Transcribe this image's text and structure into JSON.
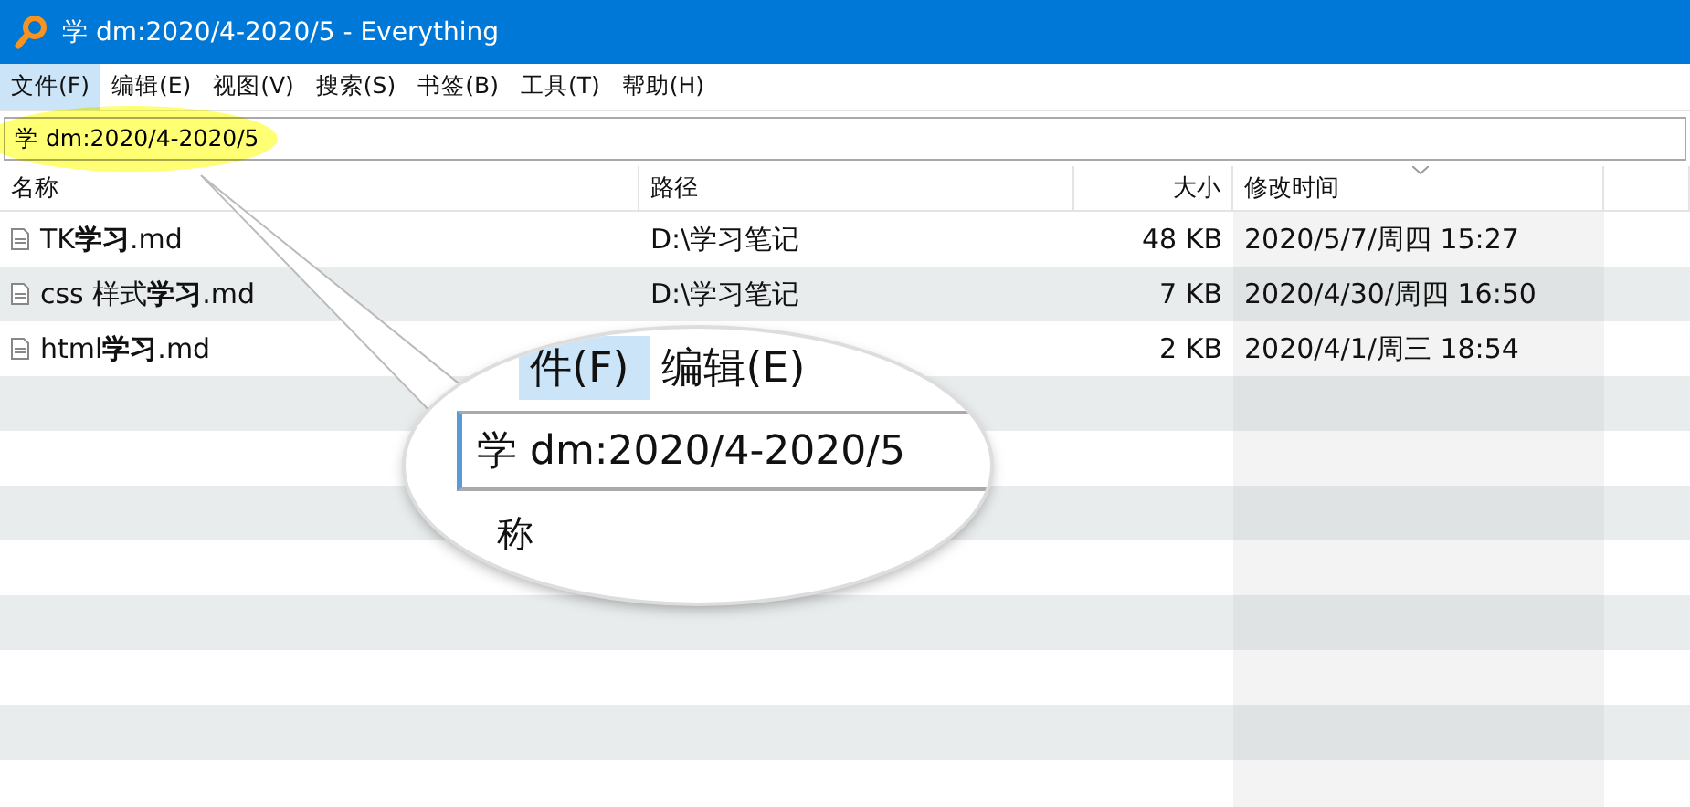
{
  "window": {
    "title": "学 dm:2020/4-2020/5 - Everything"
  },
  "menu": [
    {
      "label": "文件(F)",
      "selected": true
    },
    {
      "label": "编辑(E)",
      "selected": false
    },
    {
      "label": "视图(V)",
      "selected": false
    },
    {
      "label": "搜索(S)",
      "selected": false
    },
    {
      "label": "书签(B)",
      "selected": false
    },
    {
      "label": "工具(T)",
      "selected": false
    },
    {
      "label": "帮助(H)",
      "selected": false
    }
  ],
  "search": {
    "value": "学 dm:2020/4-2020/5"
  },
  "table": {
    "columns": [
      "名称",
      "路径",
      "大小",
      "修改时间"
    ],
    "rows": [
      {
        "name": "TK**学习**.md",
        "path": "D:\\学习笔记",
        "size": "48 KB",
        "modified": "2020/5/7/周四 15:27"
      },
      {
        "name": "css 样式**学习**.md",
        "path": "D:\\学习笔记",
        "size": "7 KB",
        "modified": "2020/4/30/周四 16:50"
      },
      {
        "name": "html**学习**.md",
        "size": "2 KB",
        "modified": "2020/4/1/周三 18:54"
      }
    ]
  },
  "magnifier": {
    "menu": [
      "件(F)",
      "编辑(E)"
    ],
    "search": "学 dm:2020/4-2020/5",
    "header": "称"
  }
}
